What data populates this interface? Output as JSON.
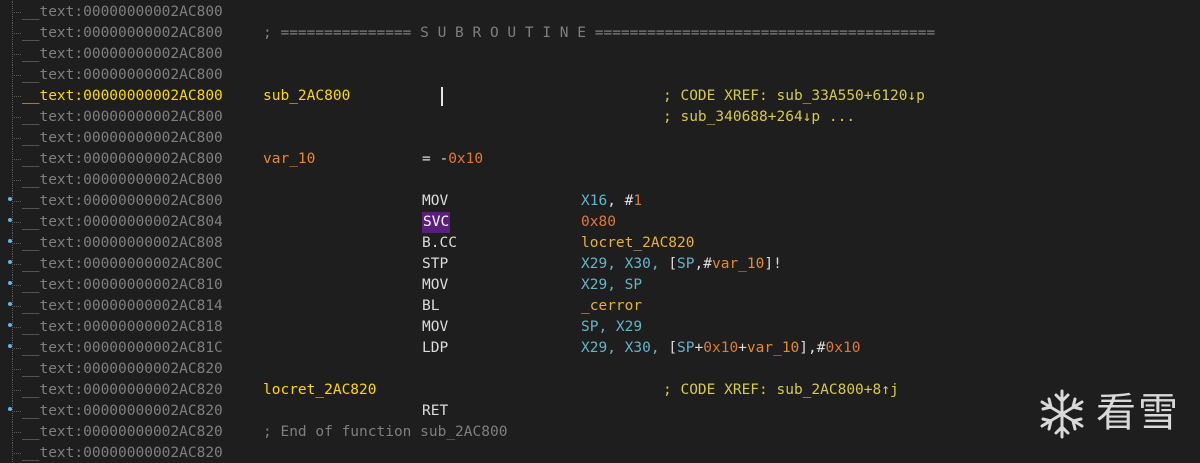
{
  "colors": {
    "background": "#1e1e1e",
    "address": "#7f7f7f",
    "current_address": "#ffd700",
    "label": "#ffd700",
    "mnemonic": "#dcdcdc",
    "operand": "#64b5c9",
    "comment": "#d7c94a",
    "number": "#e0783a",
    "highlight": "#5b1e7a",
    "gutter_dot": "#5fb7e8"
  },
  "listing": {
    "lines": [
      {
        "addr": "__text:00000000002AC800"
      },
      {
        "addr": "__text:00000000002AC800",
        "sep": "; =============== S U B R O U T I N E ======================================="
      },
      {
        "addr": "__text:00000000002AC800"
      },
      {
        "addr": "__text:00000000002AC800"
      },
      {
        "addr": "__text:00000000002AC800",
        "label": "sub_2AC800",
        "comment": "; CODE XREF: sub_33A550+6120↓p"
      },
      {
        "addr": "__text:00000000002AC800",
        "comment": "; sub_340688+264↓p ..."
      },
      {
        "addr": "__text:00000000002AC800"
      },
      {
        "addr": "__text:00000000002AC800",
        "label": "var_10",
        "eq_text": "= -",
        "eq_num": "0x10"
      },
      {
        "addr": "__text:00000000002AC800"
      },
      {
        "addr": "__text:00000000002AC800",
        "mnem": "MOV",
        "ops": {
          "r1": "X16",
          "p1": ", #",
          "n1": "1"
        }
      },
      {
        "addr": "__text:00000000002AC804",
        "mnem": "SVC",
        "ops": {
          "n1": "0x80"
        }
      },
      {
        "addr": "__text:00000000002AC808",
        "mnem": "B.CC",
        "ops": {
          "s1": "locret_2AC820"
        }
      },
      {
        "addr": "__text:00000000002AC80C",
        "mnem": "STP",
        "ops": {
          "r1": "X29, X30, ",
          "p1": "[",
          "r2": "SP",
          "p2": ",#",
          "v1": "var_10",
          "p3": "]!"
        }
      },
      {
        "addr": "__text:00000000002AC810",
        "mnem": "MOV",
        "ops": {
          "r1": "X29, SP"
        }
      },
      {
        "addr": "__text:00000000002AC814",
        "mnem": "BL",
        "ops": {
          "s1": "_cerror"
        }
      },
      {
        "addr": "__text:00000000002AC818",
        "mnem": "MOV",
        "ops": {
          "r1": "SP, X29"
        }
      },
      {
        "addr": "__text:00000000002AC81C",
        "mnem": "LDP",
        "ops": {
          "r1": "X29, X30, ",
          "p1": "[",
          "r2": "SP",
          "p2": "+",
          "n1": "0x10",
          "p3": "+",
          "v1": "var_10",
          "p4": "],#",
          "n2": "0x10"
        }
      },
      {
        "addr": "__text:00000000002AC820"
      },
      {
        "addr": "__text:00000000002AC820",
        "label": "locret_2AC820",
        "comment": "; CODE XREF: sub_2AC800+8↑j"
      },
      {
        "addr": "__text:00000000002AC820",
        "mnem": "RET"
      },
      {
        "addr": "__text:00000000002AC820",
        "sep": "; End of function sub_2AC800"
      },
      {
        "addr": "__text:00000000002AC820"
      }
    ]
  },
  "watermark": {
    "text": "看雪",
    "icon": "snowflake-icon"
  }
}
